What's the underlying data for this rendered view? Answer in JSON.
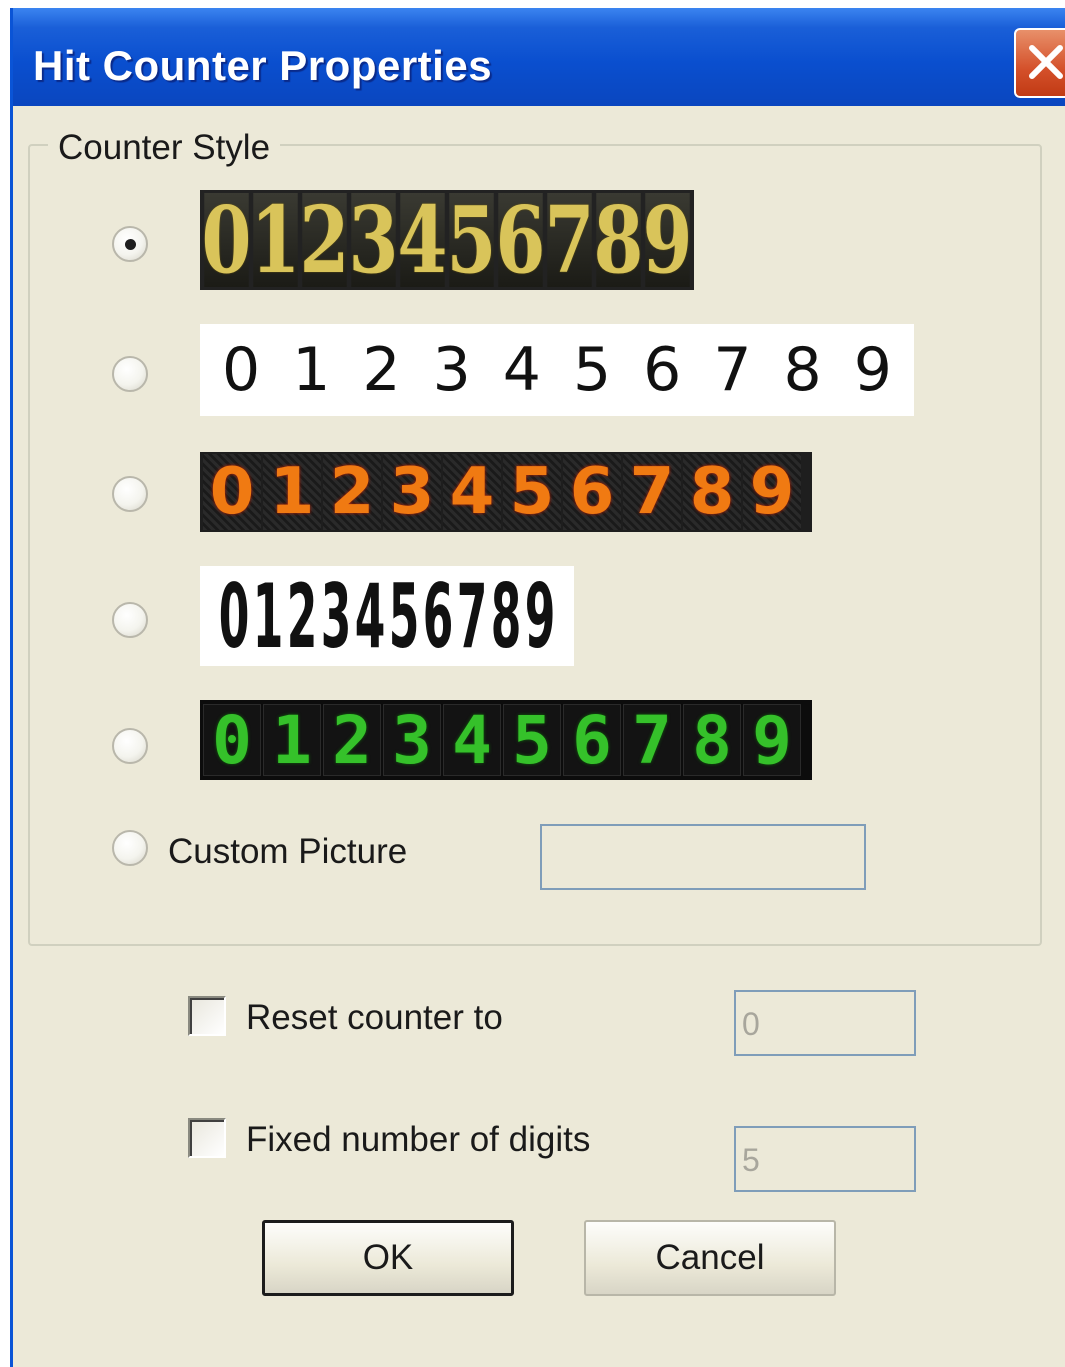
{
  "window": {
    "title": "Hit Counter Properties"
  },
  "group": {
    "label": "Counter Style"
  },
  "styles": {
    "digits": [
      "0",
      "1",
      "2",
      "3",
      "4",
      "5",
      "6",
      "7",
      "8",
      "9"
    ],
    "selected_index": 0
  },
  "custom_picture": {
    "label": "Custom Picture",
    "value": ""
  },
  "reset": {
    "label": "Reset counter to",
    "value": "0",
    "checked": false
  },
  "fixed": {
    "label": "Fixed number of digits",
    "value": "5",
    "checked": false
  },
  "buttons": {
    "ok": "OK",
    "cancel": "Cancel"
  },
  "icons": {
    "close": "close-icon"
  },
  "colors": {
    "titlebar": "#0a4fcf",
    "dialog_bg": "#ece9d8",
    "close_button": "#d4502a",
    "style1_digit": "#d9c45a",
    "style3_digit": "#f07a12",
    "style5_digit": "#35c12a"
  }
}
